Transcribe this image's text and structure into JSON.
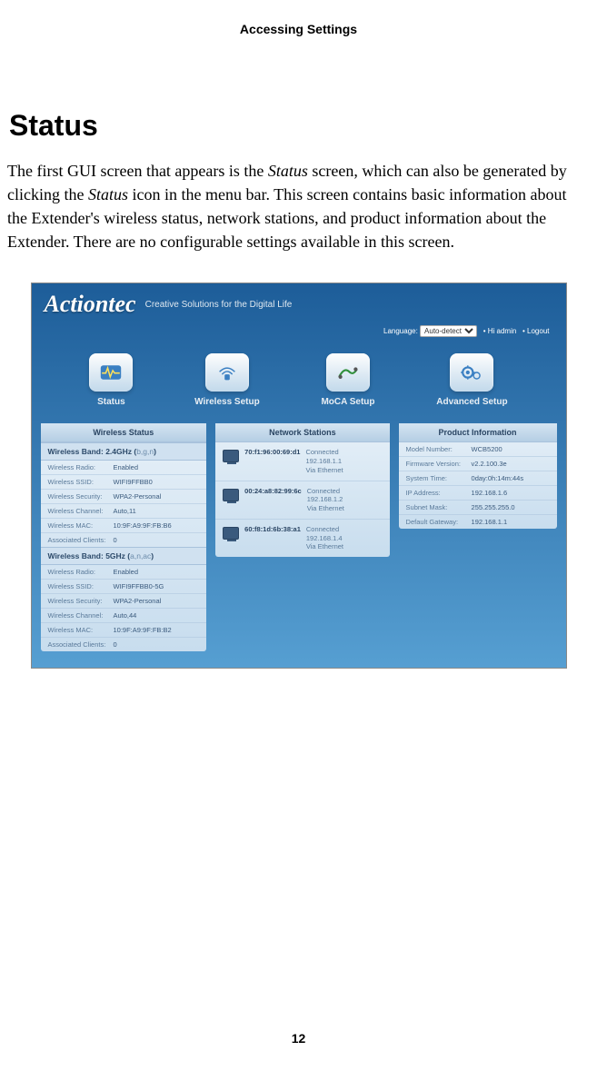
{
  "doc": {
    "header": "Accessing Settings",
    "title": "Status",
    "para_pre": "The first GUI screen that appears is the ",
    "para_italic1": "Status",
    "para_mid1": " screen, which can also be generated by clicking the ",
    "para_italic2": "Status",
    "para_mid2": " icon in the menu bar. This screen contains basic information about the Extender's wireless status, network stations, and product information about the Extender. There are no configurable settings available in this screen.",
    "page_number": "12"
  },
  "gui": {
    "brand": "Actiontec",
    "tagline": "Creative Solutions for the Digital Life",
    "topbar": {
      "lang_label": "Language",
      "lang_value": "Auto-detect",
      "greeting": "Hi admin",
      "logout": "Logout"
    },
    "nav": {
      "status": "Status",
      "wireless": "Wireless Setup",
      "moca": "MoCA Setup",
      "advanced": "Advanced Setup"
    },
    "wireless_status": {
      "header": "Wireless Status",
      "band24": {
        "label": "Wireless Band: 2.4GHz (",
        "modes": "b,g,n",
        "close": ")",
        "rows": [
          {
            "k": "Wireless Radio:",
            "v": "Enabled"
          },
          {
            "k": "Wireless SSID:",
            "v": "WIFI9FFBB0"
          },
          {
            "k": "Wireless Security:",
            "v": "WPA2-Personal"
          },
          {
            "k": "Wireless Channel:",
            "v": "Auto,11"
          },
          {
            "k": "Wireless MAC:",
            "v": "10:9F:A9:9F:FB:B6"
          },
          {
            "k": "Associated Clients:",
            "v": "0"
          }
        ]
      },
      "band5": {
        "label": "Wireless Band: 5GHz (",
        "modes": "a,n,ac",
        "close": ")",
        "rows": [
          {
            "k": "Wireless Radio:",
            "v": "Enabled"
          },
          {
            "k": "Wireless SSID:",
            "v": "WIFI9FFBB0-5G"
          },
          {
            "k": "Wireless Security:",
            "v": "WPA2-Personal"
          },
          {
            "k": "Wireless Channel:",
            "v": "Auto,44"
          },
          {
            "k": "Wireless MAC:",
            "v": "10:9F:A9:9F:FB:B2"
          },
          {
            "k": "Associated Clients:",
            "v": "0"
          }
        ]
      }
    },
    "network_stations": {
      "header": "Network Stations",
      "items": [
        {
          "mac": "70:f1:96:00:69:d1",
          "status": "Connected",
          "ip": "192.168.1.1",
          "via": "Via Ethernet"
        },
        {
          "mac": "00:24:a8:82:99:6c",
          "status": "Connected",
          "ip": "192.168.1.2",
          "via": "Via Ethernet"
        },
        {
          "mac": "60:f8:1d:6b:38:a1",
          "status": "Connected",
          "ip": "192.168.1.4",
          "via": "Via Ethernet"
        }
      ]
    },
    "product_info": {
      "header": "Product Information",
      "rows": [
        {
          "k": "Model Number:",
          "v": "WCB5200"
        },
        {
          "k": "Firmware Version:",
          "v": "v2.2.100.3e"
        },
        {
          "k": "System Time:",
          "v": "0day:0h:14m:44s"
        },
        {
          "k": "IP Address:",
          "v": "192.168.1.6"
        },
        {
          "k": "Subnet Mask:",
          "v": "255.255.255.0"
        },
        {
          "k": "Default Gateway:",
          "v": "192.168.1.1"
        }
      ]
    }
  }
}
